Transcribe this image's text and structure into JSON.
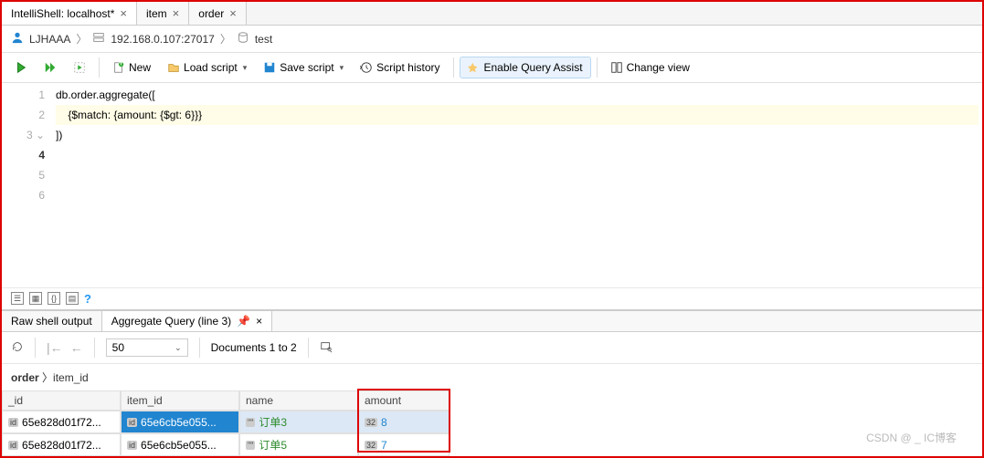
{
  "tabs": [
    {
      "label": "IntelliShell: localhost*",
      "active": true
    },
    {
      "label": "item",
      "active": false
    },
    {
      "label": "order",
      "active": false
    }
  ],
  "breadcrumb": {
    "user": "LJHAAA",
    "host": "192.168.0.107:27017",
    "db": "test"
  },
  "toolbar": {
    "new": "New",
    "load": "Load script",
    "save": "Save script",
    "history": "Script history",
    "assist": "Enable Query Assist",
    "view": "Change view"
  },
  "code": {
    "lines": [
      "",
      "",
      "db.order.aggregate([",
      "    {$match: {amount: {$gt: 6}}}",
      "])",
      ""
    ],
    "highlight": 4,
    "gutter": [
      "1",
      "2",
      "3 ⌄",
      "4",
      "5",
      "6"
    ]
  },
  "result_tabs": [
    {
      "label": "Raw shell output",
      "active": false
    },
    {
      "label": "Aggregate Query (line 3)",
      "active": true,
      "pinned": true
    }
  ],
  "pager": {
    "size": "50",
    "info": "Documents 1 to 2"
  },
  "path": {
    "coll": "order",
    "field": "item_id"
  },
  "grid": {
    "cols": [
      "_id",
      "item_id",
      "name",
      "amount"
    ],
    "rows": [
      {
        "_id": "65e828d01f72...",
        "item_id": "65e6cb5e055...",
        "name": "订单3",
        "amount": "8",
        "selected": true
      },
      {
        "_id": "65e828d01f72...",
        "item_id": "65e6cb5e055...",
        "name": "订单5",
        "amount": "7",
        "selected": false
      }
    ]
  },
  "watermark": "CSDN @ _ IC博客"
}
